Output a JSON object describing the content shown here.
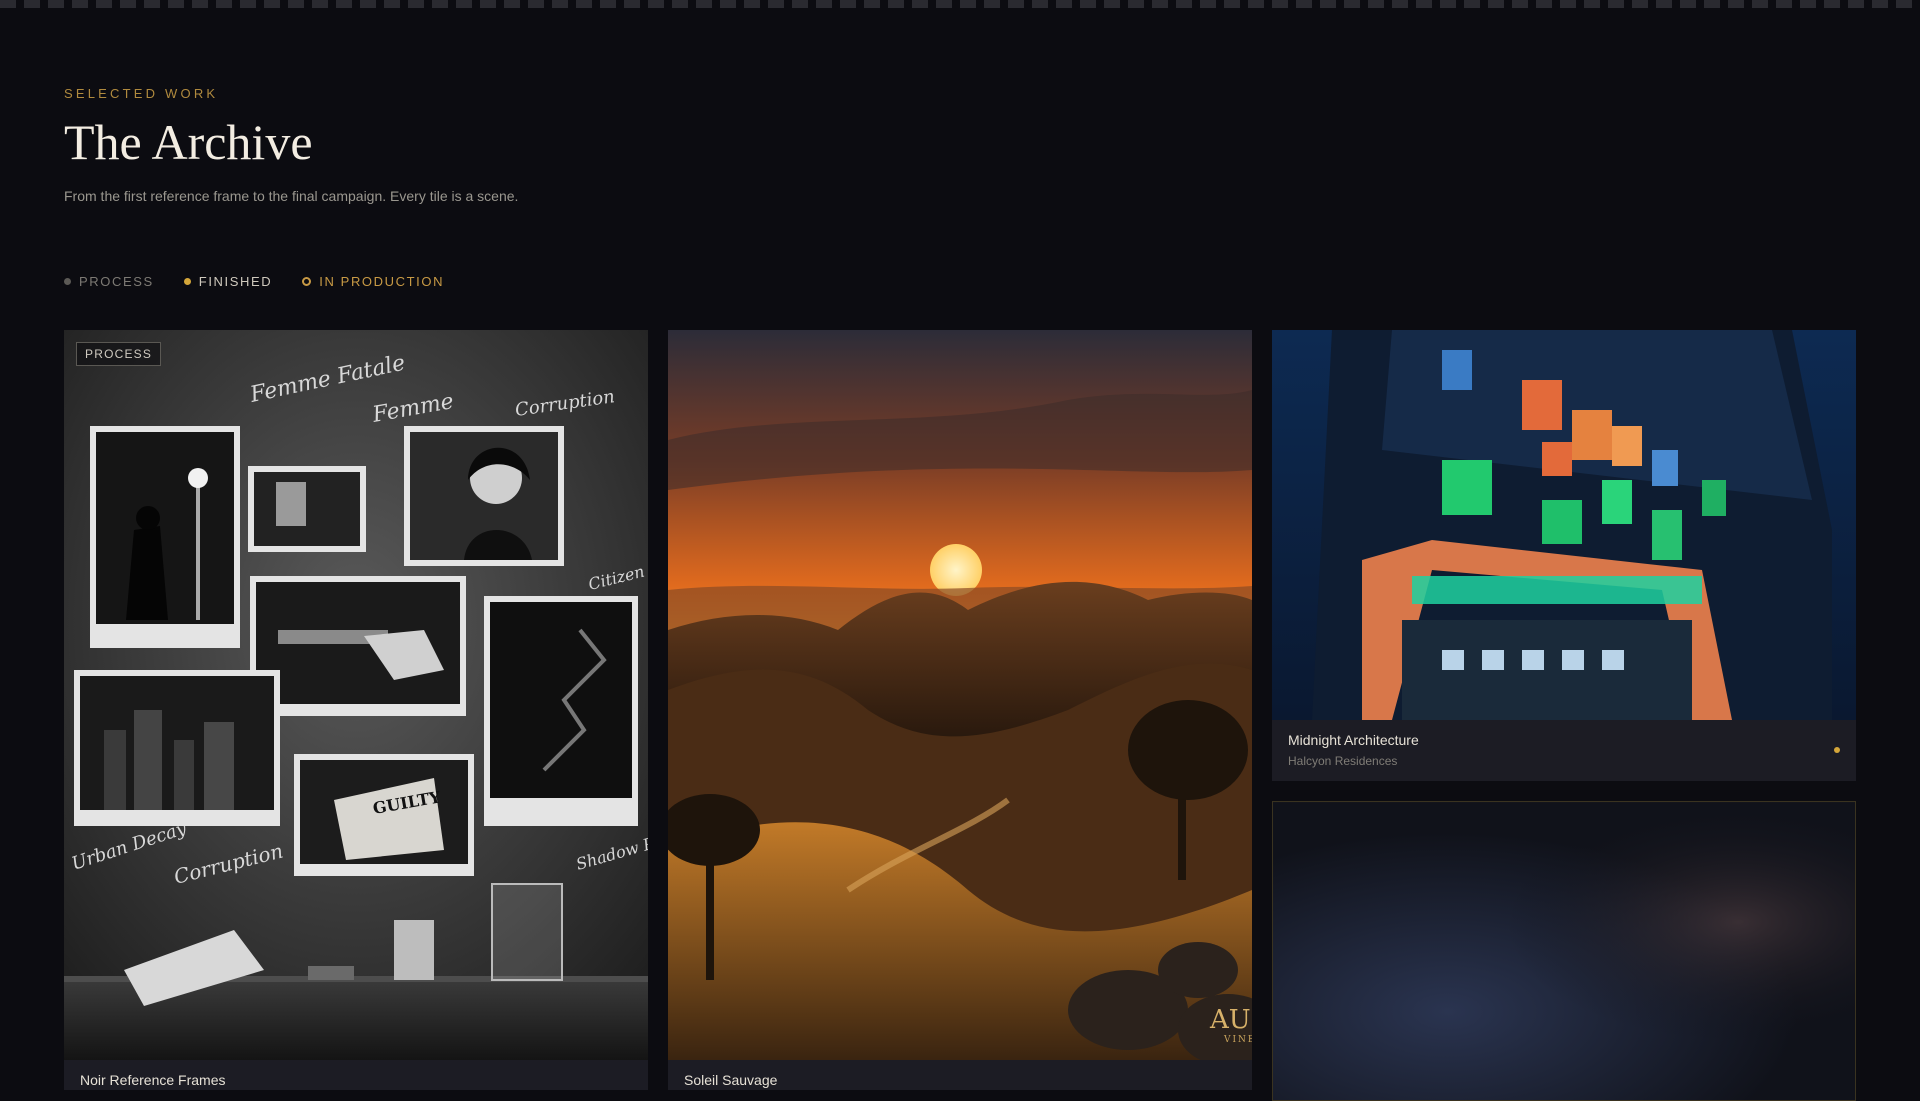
{
  "header": {
    "eyebrow": "SELECTED WORK",
    "title": "The Archive",
    "subtitle": "From the first reference frame to the final campaign. Every tile is a scene."
  },
  "filters": [
    {
      "label": "PROCESS",
      "color": "#5c5a56"
    },
    {
      "label": "FINISHED",
      "color": "#d4a63a"
    },
    {
      "label": "IN PRODUCTION",
      "color": "#c89a45"
    }
  ],
  "tiles": [
    {
      "badge": "PROCESS",
      "title": "Noir Reference Frames",
      "handwritten": [
        "Femme Fatale",
        "Femme",
        "Corruption",
        "Citizen Play",
        "Urban Decay",
        "Corruption",
        "Shadow Play"
      ],
      "newspaper": "GUILTY"
    },
    {
      "title": "Soleil Sauvage",
      "logo": "AUI",
      "logo_sub": "VINE"
    },
    {
      "title": "Midnight Architecture",
      "subtitle": "Halcyon Residences",
      "status_color": "#d4a63a"
    },
    {}
  ]
}
